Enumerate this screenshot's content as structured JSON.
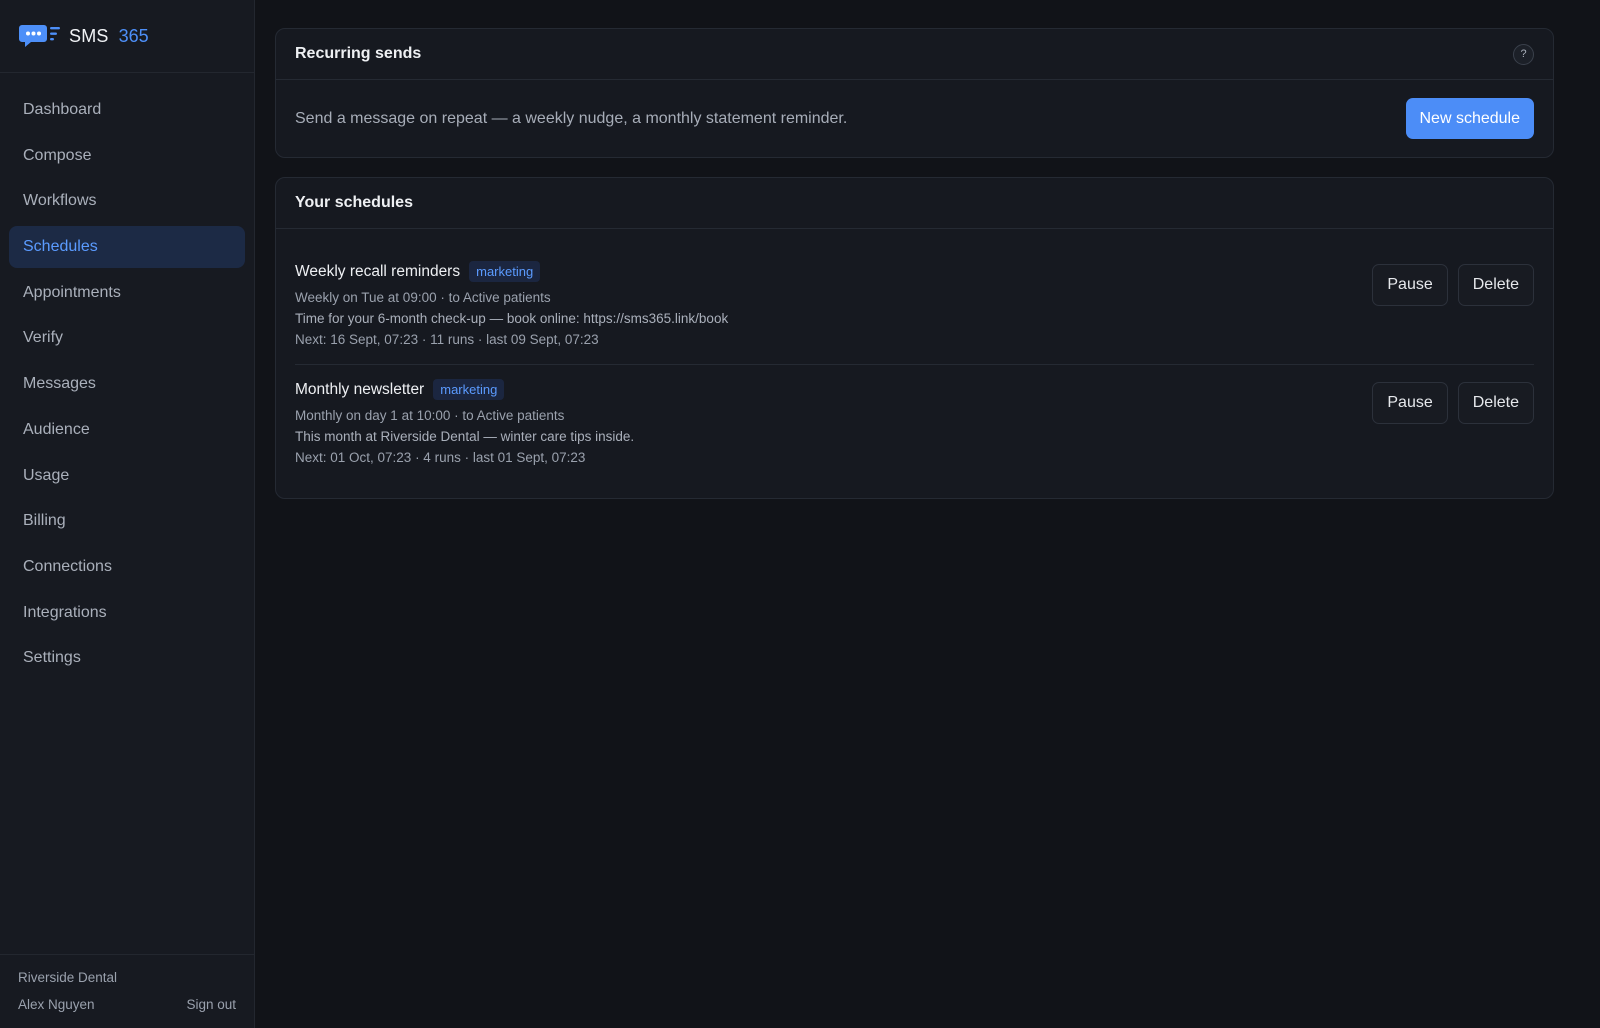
{
  "brand": {
    "name": "SMS",
    "number": "365",
    "accent": "#4d8ff8"
  },
  "sidebar": {
    "items": [
      {
        "label": "Dashboard",
        "active": false
      },
      {
        "label": "Compose",
        "active": false
      },
      {
        "label": "Workflows",
        "active": false
      },
      {
        "label": "Schedules",
        "active": true
      },
      {
        "label": "Appointments",
        "active": false
      },
      {
        "label": "Verify",
        "active": false
      },
      {
        "label": "Messages",
        "active": false
      },
      {
        "label": "Audience",
        "active": false
      },
      {
        "label": "Usage",
        "active": false
      },
      {
        "label": "Billing",
        "active": false
      },
      {
        "label": "Connections",
        "active": false
      },
      {
        "label": "Integrations",
        "active": false
      },
      {
        "label": "Settings",
        "active": false
      }
    ],
    "footer": {
      "org": "Riverside Dental",
      "user": "Alex Nguyen",
      "signout": "Sign out"
    }
  },
  "recurring": {
    "title": "Recurring sends",
    "help": "?",
    "description": "Send a message on repeat — a weekly nudge, a monthly statement reminder.",
    "new_button": "New schedule"
  },
  "schedules": {
    "title": "Your schedules",
    "items": [
      {
        "name": "Weekly recall reminders",
        "tag": "marketing",
        "cadence": "Weekly on Tue at 09:00 · to Active patients",
        "message": "Time for your 6-month check-up — book online: https://sms365.link/book",
        "next": "Next: 16 Sept, 07:23 · 11 runs · last 09 Sept, 07:23",
        "pause": "Pause",
        "delete": "Delete"
      },
      {
        "name": "Monthly newsletter",
        "tag": "marketing",
        "cadence": "Monthly on day 1 at 10:00 · to Active patients",
        "message": "This month at Riverside Dental — winter care tips inside.",
        "next": "Next: 01 Oct, 07:23 · 4 runs · last 01 Sept, 07:23",
        "pause": "Pause",
        "delete": "Delete"
      }
    ]
  }
}
